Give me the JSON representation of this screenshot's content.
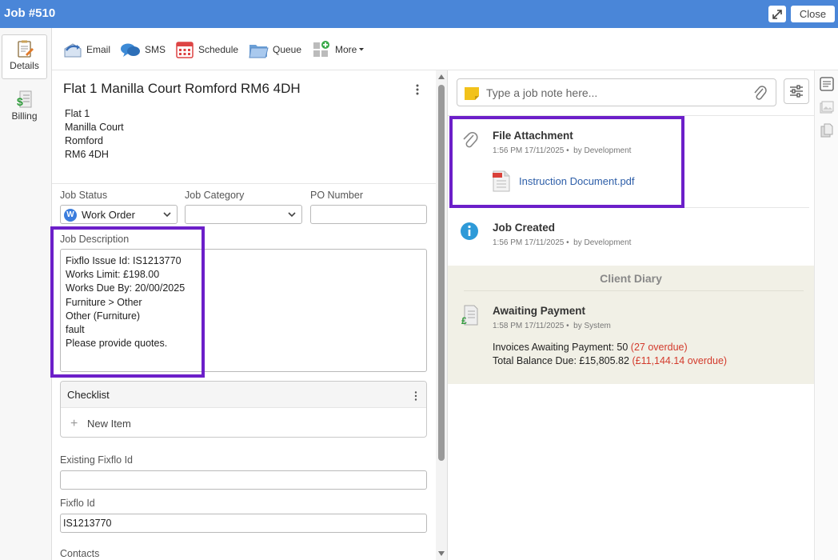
{
  "window": {
    "title": "Job #510",
    "close_label": "Close"
  },
  "nav": {
    "items": [
      {
        "label": "Details",
        "icon": "details-icon"
      },
      {
        "label": "Billing",
        "icon": "billing-icon"
      }
    ]
  },
  "toolbar": {
    "email": "Email",
    "sms": "SMS",
    "schedule": "Schedule",
    "queue": "Queue",
    "more": "More"
  },
  "address": {
    "title": "Flat 1 Manilla Court Romford RM6 4DH",
    "lines": [
      "Flat 1",
      "Manilla Court",
      "Romford",
      "RM6 4DH"
    ]
  },
  "fields": {
    "job_status_label": "Job Status",
    "job_status_value": "Work Order",
    "job_status_badge": "W",
    "job_category_label": "Job Category",
    "job_category_value": "",
    "po_number_label": "PO Number",
    "po_number_value": "",
    "job_description_label": "Job Description",
    "job_description_value": "Fixflo Issue Id: IS1213770\nWorks Limit: £198.00\nWorks Due By: 20/00/2025\nFurniture > Other\nOther (Furniture)\nfault\nPlease provide quotes.",
    "existing_fixflo_label": "Existing Fixflo Id",
    "existing_fixflo_value": "",
    "fixflo_id_label": "Fixflo Id",
    "fixflo_id_value": "IS1213770",
    "contacts_label": "Contacts"
  },
  "checklist": {
    "title": "Checklist",
    "new_item": "New Item"
  },
  "notes": {
    "placeholder": "Type a job note here..."
  },
  "timeline": [
    {
      "title": "File Attachment",
      "time": "1:56 PM 17/11/2025",
      "by": "by Development",
      "attachment": "Instruction Document.pdf"
    },
    {
      "title": "Job Created",
      "time": "1:56 PM 17/11/2025",
      "by": "by Development"
    }
  ],
  "client_diary": {
    "header": "Client Diary",
    "entry": {
      "title": "Awaiting Payment",
      "time": "1:58 PM 17/11/2025",
      "by": "by System",
      "invoices_text": "Invoices Awaiting Payment: 50",
      "invoices_overdue": "(27 overdue)",
      "balance_text": "Total Balance Due: £15,805.82",
      "balance_overdue": "(£11,144.14 overdue)"
    }
  },
  "colors": {
    "titlebar": "#4a86d8",
    "highlight": "#6c1fc9",
    "overdue": "#d33a2c",
    "link": "#2d5ea8",
    "diary_bg": "#f1f0e6"
  }
}
